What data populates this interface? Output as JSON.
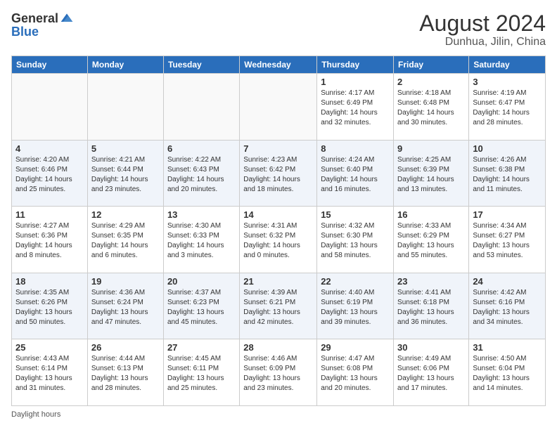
{
  "header": {
    "logo_general": "General",
    "logo_blue": "Blue",
    "month": "August 2024",
    "location": "Dunhua, Jilin, China"
  },
  "days_of_week": [
    "Sunday",
    "Monday",
    "Tuesday",
    "Wednesday",
    "Thursday",
    "Friday",
    "Saturday"
  ],
  "weeks": [
    [
      {
        "day": "",
        "detail": ""
      },
      {
        "day": "",
        "detail": ""
      },
      {
        "day": "",
        "detail": ""
      },
      {
        "day": "",
        "detail": ""
      },
      {
        "day": "1",
        "detail": "Sunrise: 4:17 AM\nSunset: 6:49 PM\nDaylight: 14 hours and 32 minutes."
      },
      {
        "day": "2",
        "detail": "Sunrise: 4:18 AM\nSunset: 6:48 PM\nDaylight: 14 hours and 30 minutes."
      },
      {
        "day": "3",
        "detail": "Sunrise: 4:19 AM\nSunset: 6:47 PM\nDaylight: 14 hours and 28 minutes."
      }
    ],
    [
      {
        "day": "4",
        "detail": "Sunrise: 4:20 AM\nSunset: 6:46 PM\nDaylight: 14 hours and 25 minutes."
      },
      {
        "day": "5",
        "detail": "Sunrise: 4:21 AM\nSunset: 6:44 PM\nDaylight: 14 hours and 23 minutes."
      },
      {
        "day": "6",
        "detail": "Sunrise: 4:22 AM\nSunset: 6:43 PM\nDaylight: 14 hours and 20 minutes."
      },
      {
        "day": "7",
        "detail": "Sunrise: 4:23 AM\nSunset: 6:42 PM\nDaylight: 14 hours and 18 minutes."
      },
      {
        "day": "8",
        "detail": "Sunrise: 4:24 AM\nSunset: 6:40 PM\nDaylight: 14 hours and 16 minutes."
      },
      {
        "day": "9",
        "detail": "Sunrise: 4:25 AM\nSunset: 6:39 PM\nDaylight: 14 hours and 13 minutes."
      },
      {
        "day": "10",
        "detail": "Sunrise: 4:26 AM\nSunset: 6:38 PM\nDaylight: 14 hours and 11 minutes."
      }
    ],
    [
      {
        "day": "11",
        "detail": "Sunrise: 4:27 AM\nSunset: 6:36 PM\nDaylight: 14 hours and 8 minutes."
      },
      {
        "day": "12",
        "detail": "Sunrise: 4:29 AM\nSunset: 6:35 PM\nDaylight: 14 hours and 6 minutes."
      },
      {
        "day": "13",
        "detail": "Sunrise: 4:30 AM\nSunset: 6:33 PM\nDaylight: 14 hours and 3 minutes."
      },
      {
        "day": "14",
        "detail": "Sunrise: 4:31 AM\nSunset: 6:32 PM\nDaylight: 14 hours and 0 minutes."
      },
      {
        "day": "15",
        "detail": "Sunrise: 4:32 AM\nSunset: 6:30 PM\nDaylight: 13 hours and 58 minutes."
      },
      {
        "day": "16",
        "detail": "Sunrise: 4:33 AM\nSunset: 6:29 PM\nDaylight: 13 hours and 55 minutes."
      },
      {
        "day": "17",
        "detail": "Sunrise: 4:34 AM\nSunset: 6:27 PM\nDaylight: 13 hours and 53 minutes."
      }
    ],
    [
      {
        "day": "18",
        "detail": "Sunrise: 4:35 AM\nSunset: 6:26 PM\nDaylight: 13 hours and 50 minutes."
      },
      {
        "day": "19",
        "detail": "Sunrise: 4:36 AM\nSunset: 6:24 PM\nDaylight: 13 hours and 47 minutes."
      },
      {
        "day": "20",
        "detail": "Sunrise: 4:37 AM\nSunset: 6:23 PM\nDaylight: 13 hours and 45 minutes."
      },
      {
        "day": "21",
        "detail": "Sunrise: 4:39 AM\nSunset: 6:21 PM\nDaylight: 13 hours and 42 minutes."
      },
      {
        "day": "22",
        "detail": "Sunrise: 4:40 AM\nSunset: 6:19 PM\nDaylight: 13 hours and 39 minutes."
      },
      {
        "day": "23",
        "detail": "Sunrise: 4:41 AM\nSunset: 6:18 PM\nDaylight: 13 hours and 36 minutes."
      },
      {
        "day": "24",
        "detail": "Sunrise: 4:42 AM\nSunset: 6:16 PM\nDaylight: 13 hours and 34 minutes."
      }
    ],
    [
      {
        "day": "25",
        "detail": "Sunrise: 4:43 AM\nSunset: 6:14 PM\nDaylight: 13 hours and 31 minutes."
      },
      {
        "day": "26",
        "detail": "Sunrise: 4:44 AM\nSunset: 6:13 PM\nDaylight: 13 hours and 28 minutes."
      },
      {
        "day": "27",
        "detail": "Sunrise: 4:45 AM\nSunset: 6:11 PM\nDaylight: 13 hours and 25 minutes."
      },
      {
        "day": "28",
        "detail": "Sunrise: 4:46 AM\nSunset: 6:09 PM\nDaylight: 13 hours and 23 minutes."
      },
      {
        "day": "29",
        "detail": "Sunrise: 4:47 AM\nSunset: 6:08 PM\nDaylight: 13 hours and 20 minutes."
      },
      {
        "day": "30",
        "detail": "Sunrise: 4:49 AM\nSunset: 6:06 PM\nDaylight: 13 hours and 17 minutes."
      },
      {
        "day": "31",
        "detail": "Sunrise: 4:50 AM\nSunset: 6:04 PM\nDaylight: 13 hours and 14 minutes."
      }
    ]
  ],
  "footer": {
    "daylight_label": "Daylight hours"
  }
}
